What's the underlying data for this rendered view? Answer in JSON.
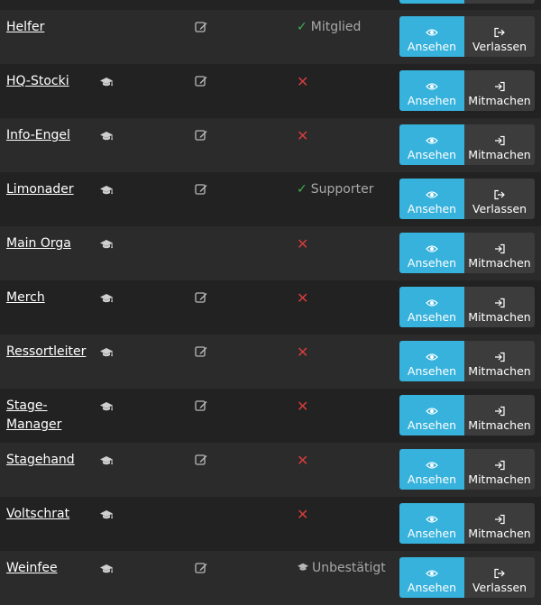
{
  "colors": {
    "accent": "#37b2dc",
    "success": "#3fb04b",
    "danger": "#d23c3c",
    "muted": "#a8a8a8"
  },
  "icons": {
    "view": "eye-icon",
    "leave": "sign-out-icon",
    "join": "sign-in-icon",
    "edit": "edit-icon",
    "requires_training": "graduation-cap-icon",
    "member": "check-icon",
    "not_member": "x-icon"
  },
  "rows": [
    {
      "name": "Helfer",
      "cap": false,
      "edit": true,
      "status": "member",
      "status_label": "Mitglied",
      "view_label": "Ansehen",
      "action_label": "Verlassen",
      "action": "leave"
    },
    {
      "name": "HQ-Stocki",
      "cap": true,
      "edit": true,
      "status": "none",
      "status_label": "",
      "view_label": "Ansehen",
      "action_label": "Mitmachen",
      "action": "join"
    },
    {
      "name": "Info-Engel",
      "cap": true,
      "edit": true,
      "status": "none",
      "status_label": "",
      "view_label": "Ansehen",
      "action_label": "Mitmachen",
      "action": "join"
    },
    {
      "name": "Limonader",
      "cap": true,
      "edit": true,
      "status": "member",
      "status_label": "Supporter",
      "view_label": "Ansehen",
      "action_label": "Verlassen",
      "action": "leave"
    },
    {
      "name": "Main Orga",
      "cap": true,
      "edit": false,
      "status": "none",
      "status_label": "",
      "view_label": "Ansehen",
      "action_label": "Mitmachen",
      "action": "join"
    },
    {
      "name": "Merch",
      "cap": true,
      "edit": true,
      "status": "none",
      "status_label": "",
      "view_label": "Ansehen",
      "action_label": "Mitmachen",
      "action": "join"
    },
    {
      "name": "Ressortleiter",
      "cap": true,
      "edit": true,
      "status": "none",
      "status_label": "",
      "view_label": "Ansehen",
      "action_label": "Mitmachen",
      "action": "join"
    },
    {
      "name": "Stage-Manager",
      "cap": true,
      "edit": true,
      "status": "none",
      "status_label": "",
      "view_label": "Ansehen",
      "action_label": "Mitmachen",
      "action": "join"
    },
    {
      "name": "Stagehand",
      "cap": true,
      "edit": true,
      "status": "none",
      "status_label": "",
      "view_label": "Ansehen",
      "action_label": "Mitmachen",
      "action": "join"
    },
    {
      "name": "Voltschrat",
      "cap": true,
      "edit": false,
      "status": "none",
      "status_label": "",
      "view_label": "Ansehen",
      "action_label": "Mitmachen",
      "action": "join"
    },
    {
      "name": "Weinfee",
      "cap": true,
      "edit": true,
      "status": "unconfirmed",
      "status_label": "Unbestätigt",
      "view_label": "Ansehen",
      "action_label": "Verlassen",
      "action": "leave"
    }
  ]
}
